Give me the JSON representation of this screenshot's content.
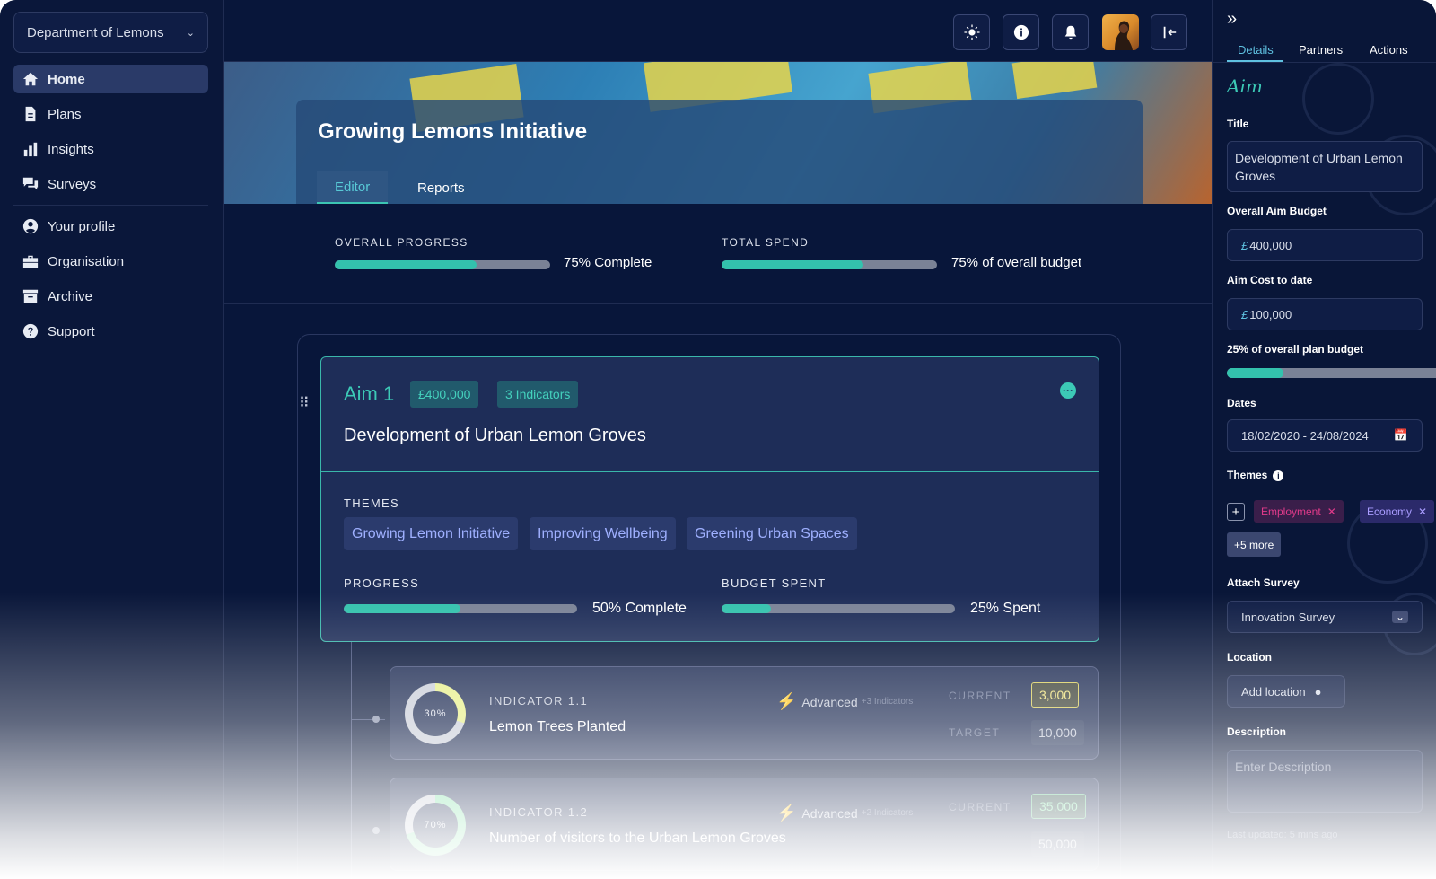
{
  "sidebar": {
    "org": "Department of Lemons",
    "items": [
      {
        "label": "Home",
        "icon": "home-icon"
      },
      {
        "label": "Plans",
        "icon": "document-icon"
      },
      {
        "label": "Insights",
        "icon": "bar-chart-icon"
      },
      {
        "label": "Surveys",
        "icon": "chat-icon"
      },
      {
        "label": "Your profile",
        "icon": "user-icon"
      },
      {
        "label": "Organisation",
        "icon": "briefcase-icon"
      },
      {
        "label": "Archive",
        "icon": "archive-icon"
      },
      {
        "label": "Support",
        "icon": "help-icon"
      }
    ]
  },
  "header": {
    "title": "Growing Lemons Initiative",
    "tabs": [
      "Editor",
      "Reports"
    ]
  },
  "stats": {
    "overall_progress_label": "OVERALL PROGRESS",
    "overall_progress_text": "75% Complete",
    "overall_progress_value": 0.66,
    "total_spend_label": "TOTAL SPEND",
    "total_spend_text": "75% of overall budget",
    "total_spend_value": 0.66
  },
  "aim": {
    "name": "Aim 1",
    "budget": "£400,000",
    "indicators_count": "3 Indicators",
    "description": "Development of Urban Lemon Groves",
    "themes_label": "THEMES",
    "themes": [
      "Growing Lemon Initiative",
      "Improving Wellbeing",
      "Greening Urban Spaces"
    ],
    "progress_label": "PROGRESS",
    "progress_text": "50% Complete",
    "progress_value": 0.5,
    "budget_label": "BUDGET SPENT",
    "budget_text": "25% Spent",
    "budget_value": 0.21
  },
  "indicators": [
    {
      "label": "INDICATOR 1.1",
      "name": "Lemon Trees Planted",
      "percent": "30%",
      "percent_value": 0.3,
      "type": "Advanced",
      "sub": "+3 Indicators",
      "current_label": "CURRENT",
      "current": "3,000",
      "target_label": "TARGET",
      "target": "10,000"
    },
    {
      "label": "INDICATOR 1.2",
      "name": "Number of visitors to the Urban Lemon Groves",
      "percent": "70%",
      "percent_value": 0.7,
      "type": "Advanced",
      "sub": "+2 Indicators",
      "current_label": "CURRENT",
      "current": "35,000",
      "target_label": "",
      "target": "50,000"
    }
  ],
  "panel": {
    "tabs": [
      "Details",
      "Partners",
      "Actions"
    ],
    "aim_heading": "Aim",
    "title_label": "Title",
    "title_value": "Development of Urban Lemon Groves",
    "budget_label": "Overall Aim Budget",
    "budget_currency": "£",
    "budget_value": "400,000",
    "cost_label": "Aim Cost to date",
    "cost_currency": "£",
    "cost_value": "100,000",
    "plan_budget_text": "25% of overall plan budget",
    "plan_budget_value": 0.25,
    "dates_label": "Dates",
    "dates_value": "18/02/2020 - 24/08/2024",
    "themes_label": "Themes",
    "theme_chips": [
      "Employment",
      "Economy"
    ],
    "more_chip": "+5 more",
    "survey_label": "Attach Survey",
    "survey_value": "Innovation Survey",
    "location_label": "Location",
    "location_button": "Add location",
    "description_label": "Description",
    "description_placeholder": "Enter Description",
    "last_updated": "Last updated: 5 mins ago"
  },
  "colors": {
    "accent": "#33c2ad",
    "background": "#08163a",
    "employment_chip": "#e03a8a",
    "economy_chip": "#8c7cff"
  }
}
